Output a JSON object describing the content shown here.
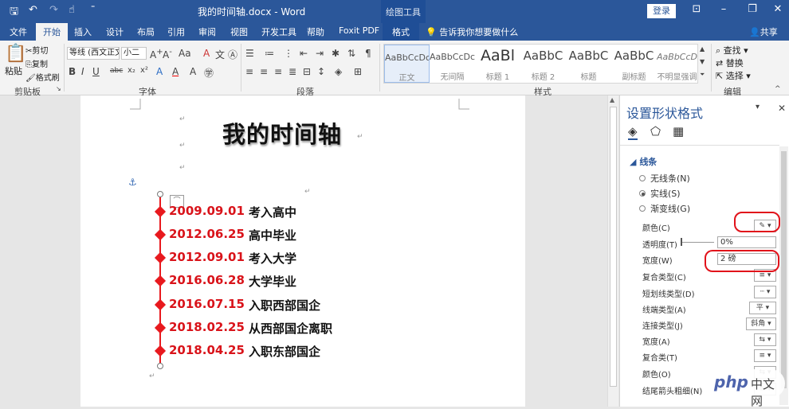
{
  "title_bar": {
    "doc_title": "我的时间轴.docx - Word",
    "context_tools": "绘图工具",
    "login": "登录",
    "quick_access": [
      "save-icon",
      "undo-icon",
      "redo-icon",
      "touch-mode-icon",
      "customize-icon"
    ]
  },
  "tabs": {
    "items": [
      "文件",
      "开始",
      "插入",
      "设计",
      "布局",
      "引用",
      "审阅",
      "视图",
      "开发工具",
      "帮助",
      "Foxit PDF"
    ],
    "active": "开始",
    "context_tab": "格式",
    "tell_me": "告诉我你想要做什么",
    "share": "共享"
  },
  "ribbon": {
    "clipboard": {
      "paste": "粘贴",
      "cut": "剪切",
      "copy": "复制",
      "format_painter": "格式刷",
      "group": "剪贴板"
    },
    "font": {
      "font_name": "等线 (西文正文",
      "font_size": "小二",
      "group": "字体"
    },
    "paragraph": {
      "group": "段落"
    },
    "styles": {
      "group": "样式",
      "items": [
        {
          "sample": "AaBbCcDc",
          "name": "正文"
        },
        {
          "sample": "AaBbCcDc",
          "name": "无间隔"
        },
        {
          "sample": "AaBl",
          "name": "标题 1"
        },
        {
          "sample": "AaBbC",
          "name": "标题 2"
        },
        {
          "sample": "AaBbC",
          "name": "标题"
        },
        {
          "sample": "AaBbC",
          "name": "副标题"
        },
        {
          "sample": "AaBbCcDc",
          "name": "不明显强调"
        }
      ]
    },
    "editing": {
      "find": "查找",
      "replace": "替换",
      "select": "选择",
      "group": "编辑"
    }
  },
  "document": {
    "heading": "我的时间轴",
    "timeline": [
      {
        "date": "2009.09.01",
        "event": "考入高中"
      },
      {
        "date": "2012.06.25",
        "event": "高中毕业"
      },
      {
        "date": "2012.09.01",
        "event": "考入大学"
      },
      {
        "date": "2016.06.28",
        "event": "大学毕业"
      },
      {
        "date": "2016.07.15",
        "event": "入职西部国企"
      },
      {
        "date": "2018.02.25",
        "event": "从西部国企离职"
      },
      {
        "date": "2018.04.25",
        "event": "入职东部国企"
      }
    ],
    "accent_color": "#d9131a"
  },
  "format_pane": {
    "title": "设置形状格式",
    "section": "线条",
    "radios": [
      {
        "label": "无线条(N)",
        "checked": false
      },
      {
        "label": "实线(S)",
        "checked": true
      },
      {
        "label": "渐变线(G)",
        "checked": false
      }
    ],
    "props": {
      "color": "颜色(C)",
      "transparency": "透明度(T)",
      "transparency_value": "0%",
      "width": "宽度(W)",
      "width_value": "2 磅",
      "compound": "复合类型(C)",
      "dash": "短划线类型(D)",
      "cap": "线端类型(A)",
      "cap_value": "平",
      "join": "连接类型(J)",
      "join_value": "斜角",
      "arrow_begin": "宽度(A)",
      "arrow_begin_type": "复合类(T)",
      "arrow_begin_size": "颜色(O)",
      "arrow_end_size": "结尾箭头粗细(N)"
    },
    "highlight_color": "#e1121a"
  },
  "watermark": {
    "text_latin": "php",
    "text_cn": "中文网"
  }
}
